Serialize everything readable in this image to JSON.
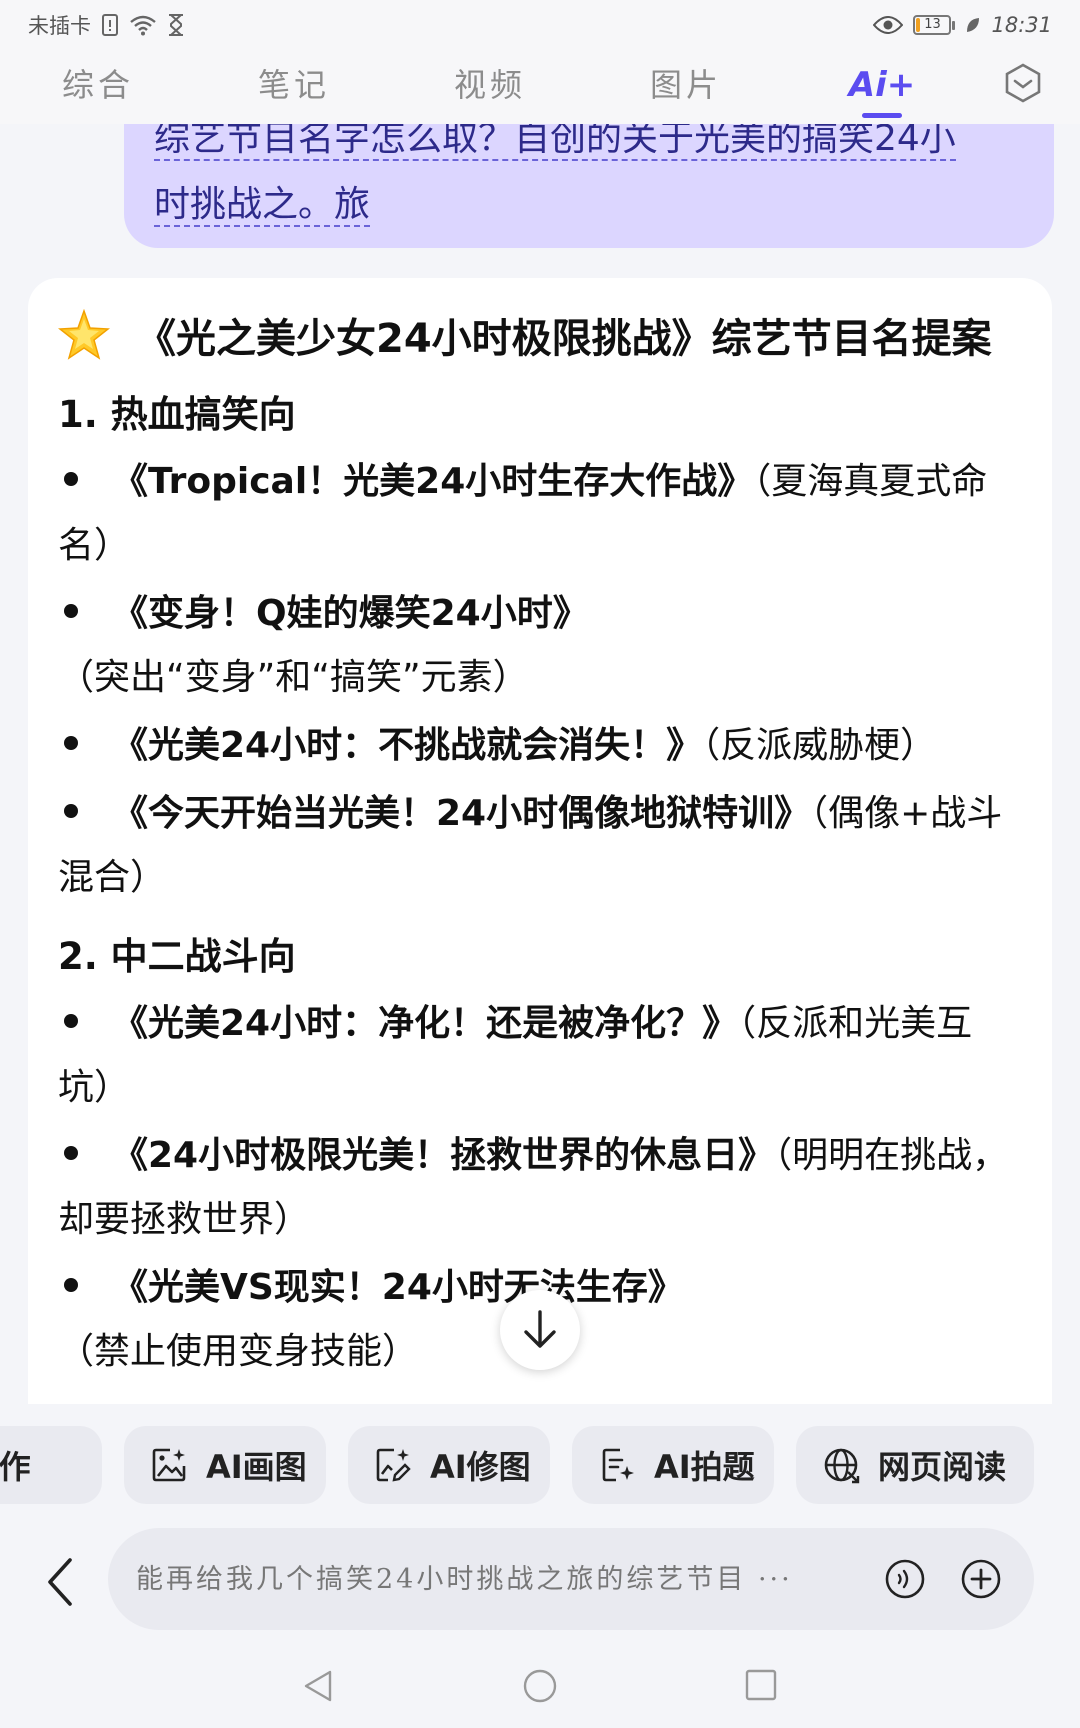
{
  "status_bar": {
    "carrier": "未插卡",
    "battery": "13",
    "battery_level": 0.13,
    "time": "18:31"
  },
  "tabs": [
    {
      "label": "综合",
      "active": false
    },
    {
      "label": "笔记",
      "active": false
    },
    {
      "label": "视频",
      "active": false
    },
    {
      "label": "图片",
      "active": false
    },
    {
      "label": "Ai+",
      "active": true
    }
  ],
  "user_message": {
    "line1": "综艺节目名字怎么取？自创的关于光美的搞笑24小",
    "line2": "时挑战之。旅"
  },
  "answer": {
    "title": "《光之美少女24小时极限挑战》综艺节目名提案",
    "sections": [
      {
        "heading": "1. 热血搞笑向",
        "items": [
          {
            "name": "《Tropical！光美24小时生存大作战》",
            "note": "（夏海真夏式命名）"
          },
          {
            "name": "《变身！Q娃的爆笑24小时》",
            "note": "（突出“变身”和“搞笑”元素）"
          },
          {
            "name": "《光美24小时：不挑战就会消失！》",
            "note": "（反派威胁梗）"
          },
          {
            "name": "《今天开始当光美！24小时偶像地狱特训》",
            "note": "（偶像+战斗混合）"
          }
        ]
      },
      {
        "heading": "2. 中二战斗向",
        "items": [
          {
            "name": "《光美24小时：净化！还是被净化？》",
            "note": "（反派和光美互坑）"
          },
          {
            "name": "《24小时极限光美！拯救世界的休息日》",
            "note": "（明明在挑战，却要拯救世界）"
          },
          {
            "name": "《光美VS现实！24小时无法生存》",
            "note": "（禁止使用变身技能）"
          }
        ]
      }
    ]
  },
  "tools": [
    {
      "label": "AI写作"
    },
    {
      "label": "AI画图"
    },
    {
      "label": "AI修图"
    },
    {
      "label": "AI拍题"
    },
    {
      "label": "网页阅读"
    }
  ],
  "input": {
    "placeholder": "能再给我几个搞笑24小时挑战之旅的综艺节目 ···"
  }
}
